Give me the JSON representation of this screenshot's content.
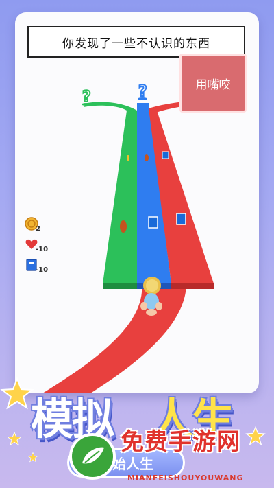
{
  "prompt_text": "你发现了一些不认识的东西",
  "action_button": "用嘴咬",
  "stats": [
    {
      "icon": "coin-icon",
      "value": "2"
    },
    {
      "icon": "heart-icon",
      "value": "-10"
    },
    {
      "icon": "book-icon",
      "value": "-10"
    }
  ],
  "choice_markers": [
    "?",
    "?"
  ],
  "game_title_part1": "模拟",
  "game_title_part2": "人生",
  "start_button": "开始人生",
  "watermark": {
    "title": "免费手游网",
    "subtitle": "MIANFEISHOUYOUWANG"
  },
  "colors": {
    "lane_green": "#2cc05a",
    "lane_blue": "#2f7df0",
    "lane_red": "#e8403e",
    "action": "#d96b6f"
  }
}
